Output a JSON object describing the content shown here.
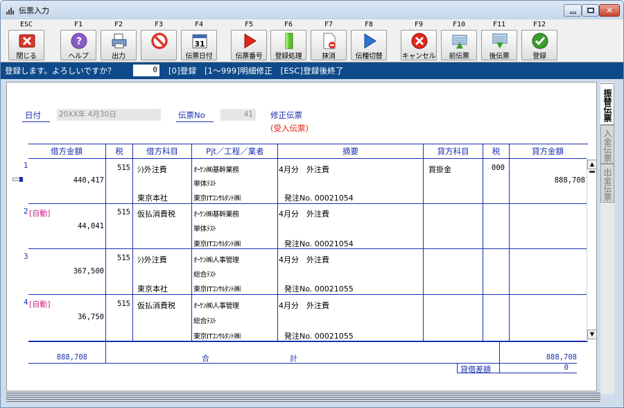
{
  "window": {
    "title": "伝票入力"
  },
  "toolbar": [
    {
      "key": "ESC",
      "label": "閉じる",
      "icon": "close-x-icon"
    },
    {
      "key": "F1",
      "label": "ヘルプ",
      "icon": "help-icon"
    },
    {
      "key": "F2",
      "label": "出力",
      "icon": "print-icon"
    },
    {
      "key": "F3",
      "label": "",
      "icon": "prohibited-icon"
    },
    {
      "key": "F4",
      "label": "伝票日付",
      "icon": "calendar-icon"
    },
    {
      "key": "F5",
      "label": "伝票番号",
      "icon": "red-play-icon"
    },
    {
      "key": "F6",
      "label": "登録処理",
      "icon": "green-bar-icon"
    },
    {
      "key": "F7",
      "label": "抹消",
      "icon": "delete-doc-icon"
    },
    {
      "key": "F8",
      "label": "伝種切替",
      "icon": "blue-play-icon"
    },
    {
      "key": "F9",
      "label": "キャンセル",
      "icon": "cancel-icon"
    },
    {
      "key": "F10",
      "label": "前伝票",
      "icon": "prev-slip-icon"
    },
    {
      "key": "F11",
      "label": "後伝票",
      "icon": "next-slip-icon"
    },
    {
      "key": "F12",
      "label": "登録",
      "icon": "check-icon"
    }
  ],
  "message": {
    "prompt": "登録します。よろしいですか？",
    "value": "0",
    "hint": "[0]登録　[1～999]明細修正　[ESC]登録後終了"
  },
  "header": {
    "date_label": "日付",
    "date_value": "20XX年 4月30日",
    "slip_no_label": "伝票No",
    "slip_no_value": "41",
    "status": "修正伝票",
    "sub_status": "(受入伝票)"
  },
  "columns": {
    "debit_amount": "借方金額",
    "tax": "税",
    "debit_account": "借方科目",
    "pjt": "Pjt／工程／業者",
    "summary": "摘要",
    "credit_account": "貸方科目",
    "credit_tax": "税",
    "credit_amount": "貸方金額"
  },
  "rows": [
    {
      "no": "1",
      "auto": "",
      "debit_amount": "440,417",
      "tax": "515",
      "debit_account": "ｼ)外注費",
      "dept": "東京本社",
      "pjt1": "ｵｰｹﾝ㈱基幹業務",
      "pjt2": "単体ﾃｽﾄ",
      "pjt3": "東京ITｺﾝｻﾙﾀﾝﾄ㈱",
      "summary1": "4月分　外注費",
      "summary2": "発注No. 00021054",
      "credit_account": "買掛金",
      "credit_tax": "000",
      "credit_amount": "888,708"
    },
    {
      "no": "2",
      "auto": "[自動]",
      "debit_amount": "44,041",
      "tax": "515",
      "debit_account": "仮払消費税",
      "dept": "",
      "pjt1": "ｵｰｹﾝ㈱基幹業務",
      "pjt2": "単体ﾃｽﾄ",
      "pjt3": "東京ITｺﾝｻﾙﾀﾝﾄ㈱",
      "summary1": "4月分　外注費",
      "summary2": "発注No. 00021054",
      "credit_account": "",
      "credit_tax": "",
      "credit_amount": ""
    },
    {
      "no": "3",
      "auto": "",
      "debit_amount": "367,500",
      "tax": "515",
      "debit_account": "ｼ)外注費",
      "dept": "東京本社",
      "pjt1": "ｵｰｹﾝ㈱人事管理",
      "pjt2": "総合ﾃｽﾄ",
      "pjt3": "東京ITｺﾝｻﾙﾀﾝﾄ㈱",
      "summary1": "4月分　外注費",
      "summary2": "発注No. 00021055",
      "credit_account": "",
      "credit_tax": "",
      "credit_amount": ""
    },
    {
      "no": "4",
      "auto": "[自動]",
      "debit_amount": "36,750",
      "tax": "515",
      "debit_account": "仮払消費税",
      "dept": "",
      "pjt1": "ｵｰｹﾝ㈱人事管理",
      "pjt2": "総合ﾃｽﾄ",
      "pjt3": "東京ITｺﾝｻﾙﾀﾝﾄ㈱",
      "summary1": "4月分　外注費",
      "summary2": "発注No. 00021055",
      "credit_account": "",
      "credit_tax": "",
      "credit_amount": ""
    }
  ],
  "totals": {
    "debit_total": "888,708",
    "label_a": "合",
    "label_b": "計",
    "credit_total": "888,708",
    "diff_label": "貸借差額",
    "diff_value": "0"
  },
  "side_tabs": [
    "振替伝票",
    "入金伝票",
    "出金伝票"
  ],
  "colors": {
    "accent_blue": "#1a2fb0",
    "message_bar": "#0e4a89",
    "red": "#e0220f",
    "magenta": "#d4208b"
  }
}
